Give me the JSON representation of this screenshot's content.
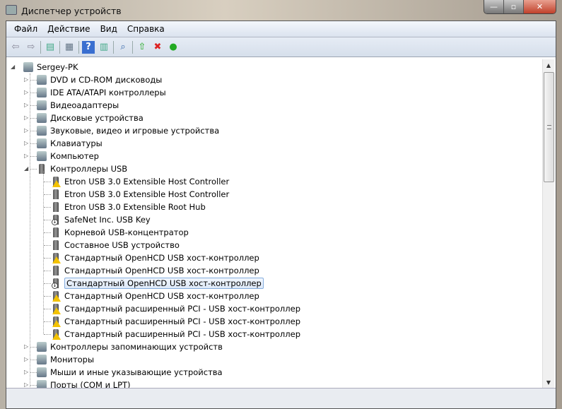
{
  "window": {
    "title": "Диспетчер устройств",
    "minimize": "—",
    "maximize": "▫",
    "close": "✕"
  },
  "menu": [
    "Файл",
    "Действие",
    "Вид",
    "Справка"
  ],
  "toolbar": [
    "back-icon",
    "forward-icon",
    "show-hide-console-tree-icon",
    "properties-icon",
    "help-icon",
    "show-action-pane-icon",
    "scan-hardware-icon",
    "update-driver-icon",
    "disable-device-icon",
    "enable-device-icon"
  ],
  "tree": {
    "root": "Sergey-PK",
    "categories_before": [
      "DVD и CD-ROM дисководы",
      "IDE ATA/ATAPI контроллеры",
      "Видеоадаптеры",
      "Дисковые устройства",
      "Звуковые, видео и игровые устройства",
      "Клавиатуры",
      "Компьютер"
    ],
    "usb": {
      "label": "Контроллеры USB",
      "children": [
        {
          "label": "Etron USB 3.0 Extensible Host Controller",
          "status": "warning"
        },
        {
          "label": "Etron USB 3.0 Extensible Host Controller",
          "status": "ok"
        },
        {
          "label": "Etron USB 3.0 Extensible Root Hub",
          "status": "ok"
        },
        {
          "label": "SafeNet Inc. USB Key",
          "status": "disabled"
        },
        {
          "label": "Корневой USB-концентратор",
          "status": "ok"
        },
        {
          "label": "Составное USB устройство",
          "status": "ok"
        },
        {
          "label": "Стандартный OpenHCD USB хост-контроллер",
          "status": "warning"
        },
        {
          "label": "Стандартный OpenHCD USB хост-контроллер",
          "status": "ok"
        },
        {
          "label": "Стандартный OpenHCD USB хост-контроллер",
          "status": "disabled",
          "selected": true
        },
        {
          "label": "Стандартный OpenHCD USB хост-контроллер",
          "status": "warning"
        },
        {
          "label": "Стандартный расширенный PCI - USB хост-контроллер",
          "status": "warning"
        },
        {
          "label": "Стандартный расширенный PCI - USB хост-контроллер",
          "status": "warning"
        },
        {
          "label": "Стандартный расширенный PCI - USB хост-контроллер",
          "status": "warning"
        }
      ]
    },
    "categories_after": [
      "Контроллеры запоминающих устройств",
      "Мониторы",
      "Мыши и иные указывающие устройства",
      "Порты (COM и LPT)"
    ]
  }
}
